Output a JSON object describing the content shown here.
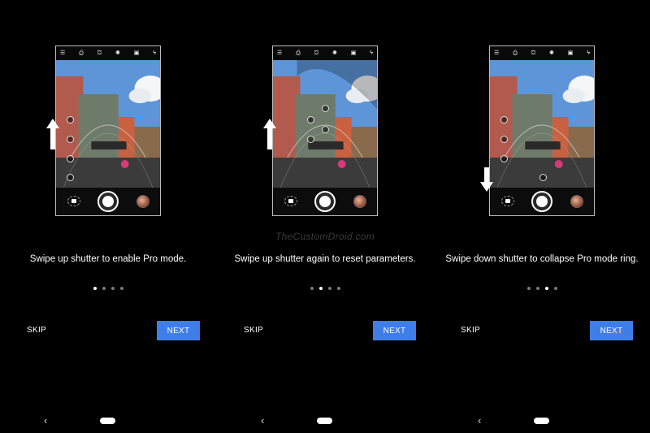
{
  "watermark": "TheCustomDroid.com",
  "topbar_icons": [
    "menu-icon",
    "camera-flip-icon",
    "portrait-icon",
    "hdr-off-icon",
    "timer-icon",
    "flash-icon"
  ],
  "panels": [
    {
      "caption": "Swipe up shutter to enable Pro mode.",
      "page_index": 1,
      "skip_label": "SKIP",
      "next_label": "NEXT",
      "gesture": "swipe-up"
    },
    {
      "caption": "Swipe up shutter again to reset parameters.",
      "page_index": 2,
      "skip_label": "SKIP",
      "next_label": "NEXT",
      "gesture": "swipe-up"
    },
    {
      "caption": "Swipe down shutter to collapse Pro mode ring.",
      "page_index": 3,
      "skip_label": "SKIP",
      "next_label": "NEXT",
      "gesture": "swipe-down"
    }
  ],
  "page_count": 4,
  "nav": {
    "back_icon": "back-chevron-icon",
    "home_icon": "home-pill-icon"
  },
  "colors": {
    "next_button": "#3f7ee6",
    "background": "#000000"
  }
}
